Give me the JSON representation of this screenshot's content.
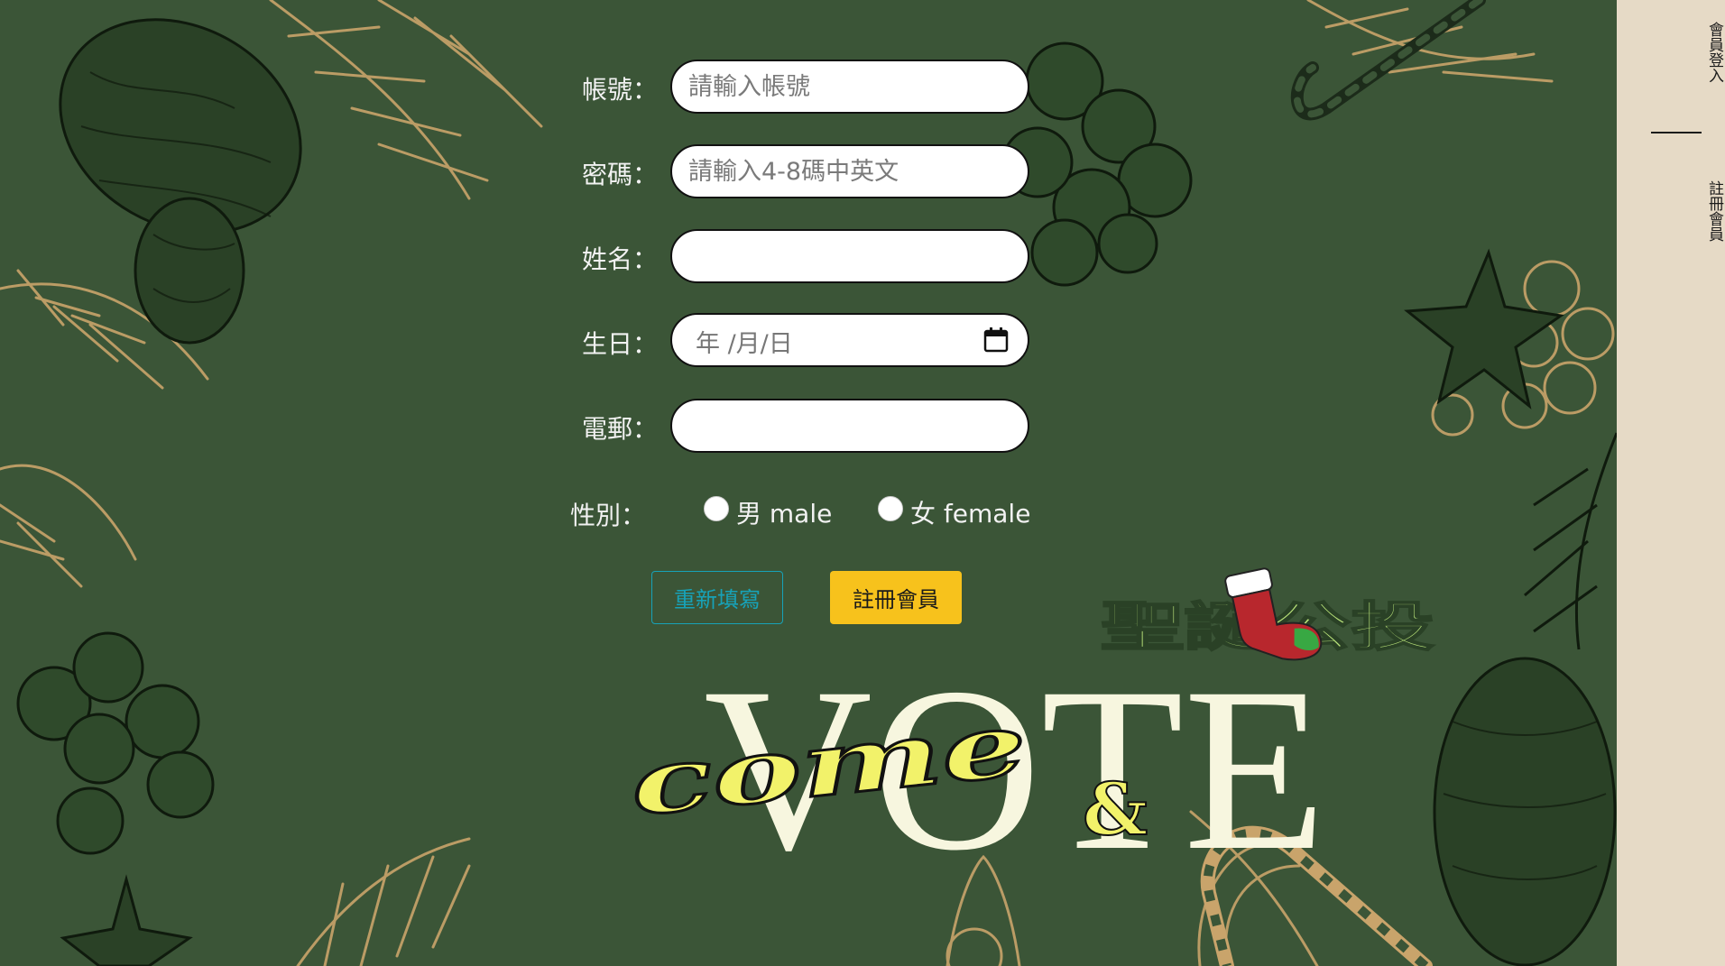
{
  "form": {
    "account": {
      "label": "帳號：",
      "placeholder": "請輸入帳號",
      "value": ""
    },
    "password": {
      "label": "密碼：",
      "placeholder": "請輸入4-8碼中英文",
      "value": ""
    },
    "name": {
      "label": "姓名：",
      "value": ""
    },
    "birthday": {
      "label": "生日：",
      "placeholder": "年 /月/日"
    },
    "email": {
      "label": "電郵：",
      "value": ""
    },
    "gender": {
      "label": "性別：",
      "options": [
        {
          "label": "男 male",
          "checked": false
        },
        {
          "label": "女 female",
          "checked": false
        }
      ]
    },
    "reset_label": "重新填寫",
    "submit_label": "註冊會員"
  },
  "sidebar": {
    "items": [
      {
        "label": "會員登入"
      },
      {
        "label": "註冊會員"
      }
    ]
  },
  "logo": {
    "headline": "聖誕公投",
    "script_word": "come",
    "ampersand": "&",
    "big_word": "VOTE"
  },
  "colors": {
    "background": "#3b5537",
    "sidebar": "#e6dac6",
    "submit": "#f7c21c",
    "reset_outline": "#17a2b8",
    "logo_cream": "#f7f6df",
    "logo_yellow": "#f2f26a",
    "logo_green": "#b9e37a"
  },
  "icons": [
    "calendar-icon",
    "stocking-icon"
  ]
}
